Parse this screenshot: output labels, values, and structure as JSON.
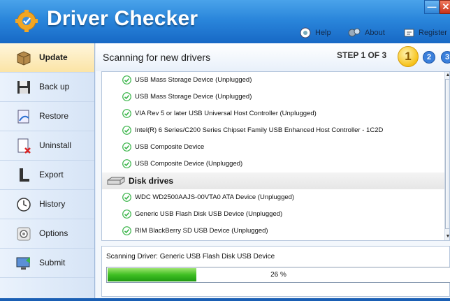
{
  "app": {
    "title": "Driver Checker"
  },
  "titlebar": {
    "minimize_glyph": "—",
    "close_glyph": "✕",
    "help_label": "Help",
    "about_label": "About",
    "register_label": "Register"
  },
  "sidebar": {
    "items": [
      {
        "label": "Update",
        "icon": "box-icon",
        "active": true
      },
      {
        "label": "Back up",
        "icon": "floppy-icon"
      },
      {
        "label": "Restore",
        "icon": "restore-icon"
      },
      {
        "label": "Uninstall",
        "icon": "uninstall-icon"
      },
      {
        "label": "Export",
        "icon": "export-icon"
      },
      {
        "label": "History",
        "icon": "clock-icon"
      },
      {
        "label": "Options",
        "icon": "gear-icon"
      },
      {
        "label": "Submit",
        "icon": "monitor-icon"
      }
    ]
  },
  "main": {
    "scan_title": "Scanning for new drivers",
    "step_text": "STEP 1 OF 3",
    "steps": [
      "1",
      "2",
      "3"
    ],
    "devices": [
      "USB Mass Storage Device (Unplugged)",
      "USB Mass Storage Device (Unplugged)",
      "VIA Rev 5 or later USB Universal Host Controller (Unplugged)",
      "Intel(R) 6 Series/C200 Series Chipset Family USB Enhanced Host Controller - 1C2D",
      "USB Composite Device",
      "USB Composite Device (Unplugged)"
    ],
    "category": "Disk drives",
    "disk_devices": [
      "WDC WD2500AAJS-00VTA0 ATA Device (Unplugged)",
      "Generic USB Flash Disk USB Device (Unplugged)",
      "RIM BlackBerry SD USB Device (Unplugged)"
    ],
    "status_label": "Scanning Driver:  Generic USB Flash Disk USB Device",
    "progress_text": "26 %",
    "progress_fraction": 0.26
  },
  "colors": {
    "accent": "#2a86db",
    "progress": "#3fbf23",
    "check": "#3bb54a"
  }
}
